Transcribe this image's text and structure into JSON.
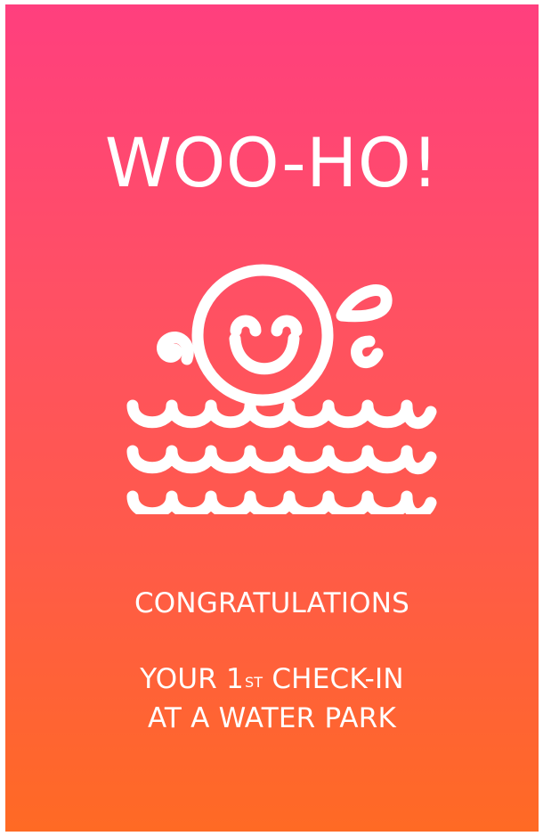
{
  "card": {
    "headline": "WOO-HO!",
    "illustration_icon": "smiley-splashing-in-water-icon",
    "congrats": "CONGRATULATIONS",
    "message": {
      "line1_prefix": "YOUR 1",
      "line1_superscript": "ST",
      "line1_suffix": " CHECK-IN",
      "line2": "AT A WATER PARK"
    },
    "colors": {
      "gradient_top": "#ff3f7e",
      "gradient_bottom": "#ff6a24",
      "foreground": "#ffffff"
    }
  }
}
